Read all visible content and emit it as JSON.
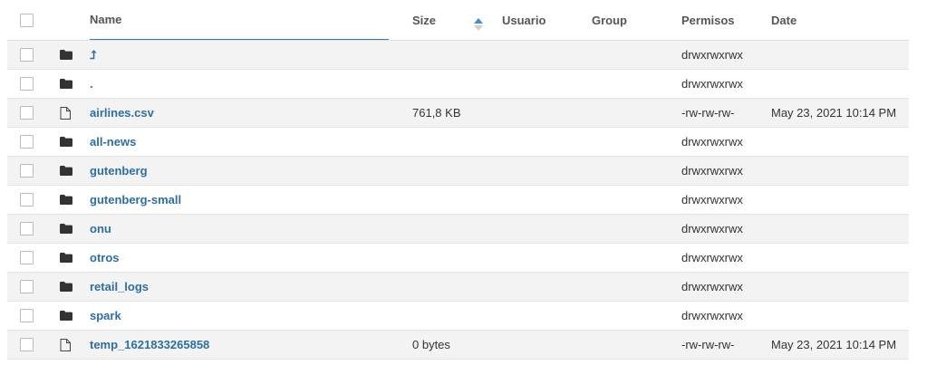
{
  "header": {
    "name": "Name",
    "size": "Size",
    "user": "Usuario",
    "group": "Group",
    "permissions": "Permisos",
    "date": "Date"
  },
  "colors": {
    "link": "#2e6ea0",
    "sort_up": "#4a8cc7",
    "sort_down": "#cfcfcf",
    "alt_row": "#f3f3f3"
  },
  "rows": [
    {
      "type": "folder",
      "icon": "folder-icon",
      "name": "⮥",
      "size": "",
      "user": "",
      "group": "",
      "perm": "drwxrwxrwx",
      "date": ""
    },
    {
      "type": "folder",
      "icon": "folder-icon",
      "name": ".",
      "size": "",
      "user": "",
      "group": "",
      "perm": "drwxrwxrwx",
      "date": ""
    },
    {
      "type": "file",
      "icon": "file-icon",
      "name": "airlines.csv",
      "size": "761,8 KB",
      "user": "",
      "group": "",
      "perm": "-rw-rw-rw-",
      "date": "May 23, 2021 10:14 PM"
    },
    {
      "type": "folder",
      "icon": "folder-icon",
      "name": "all-news",
      "size": "",
      "user": "",
      "group": "",
      "perm": "drwxrwxrwx",
      "date": ""
    },
    {
      "type": "folder",
      "icon": "folder-icon",
      "name": "gutenberg",
      "size": "",
      "user": "",
      "group": "",
      "perm": "drwxrwxrwx",
      "date": ""
    },
    {
      "type": "folder",
      "icon": "folder-icon",
      "name": "gutenberg-small",
      "size": "",
      "user": "",
      "group": "",
      "perm": "drwxrwxrwx",
      "date": ""
    },
    {
      "type": "folder",
      "icon": "folder-icon",
      "name": "onu",
      "size": "",
      "user": "",
      "group": "",
      "perm": "drwxrwxrwx",
      "date": ""
    },
    {
      "type": "folder",
      "icon": "folder-icon",
      "name": "otros",
      "size": "",
      "user": "",
      "group": "",
      "perm": "drwxrwxrwx",
      "date": ""
    },
    {
      "type": "folder",
      "icon": "folder-icon",
      "name": "retail_logs",
      "size": "",
      "user": "",
      "group": "",
      "perm": "drwxrwxrwx",
      "date": ""
    },
    {
      "type": "folder",
      "icon": "folder-icon",
      "name": "spark",
      "size": "",
      "user": "",
      "group": "",
      "perm": "drwxrwxrwx",
      "date": ""
    },
    {
      "type": "file",
      "icon": "file-icon",
      "name": "temp_1621833265858",
      "size": "0 bytes",
      "user": "",
      "group": "",
      "perm": "-rw-rw-rw-",
      "date": "May 23, 2021 10:14 PM"
    }
  ]
}
